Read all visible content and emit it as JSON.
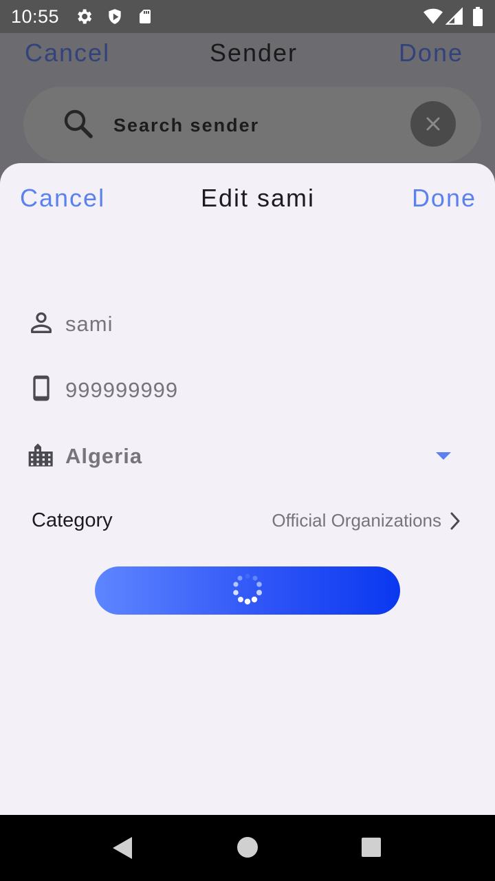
{
  "status_bar": {
    "time": "10:55",
    "icons": [
      "settings-icon",
      "shield-icon",
      "sd-card-icon",
      "wifi-icon",
      "signal-icon",
      "battery-icon"
    ]
  },
  "background_page": {
    "cancel_label": "Cancel",
    "title": "Sender",
    "done_label": "Done",
    "search": {
      "placeholder": "Search sender",
      "icon": "search-icon",
      "clear_icon": "close-icon"
    }
  },
  "sheet": {
    "cancel_label": "Cancel",
    "title": "Edit sami",
    "done_label": "Done",
    "fields": {
      "name": {
        "icon": "person-icon",
        "value": "sami"
      },
      "phone": {
        "icon": "phone-icon",
        "value": "999999999"
      },
      "country": {
        "icon": "building-icon",
        "value": "Algeria"
      }
    },
    "category": {
      "label": "Category",
      "value": "Official Organizations"
    },
    "submit_button": {
      "state": "loading"
    }
  },
  "nav_bar": {
    "icons": [
      "back-icon",
      "home-icon",
      "recents-icon"
    ]
  },
  "colors": {
    "accent": "#5b80f0",
    "sheet_background": "#f4f0f8",
    "button_gradient_start": "#5e86ff",
    "button_gradient_end": "#0a38f0"
  }
}
